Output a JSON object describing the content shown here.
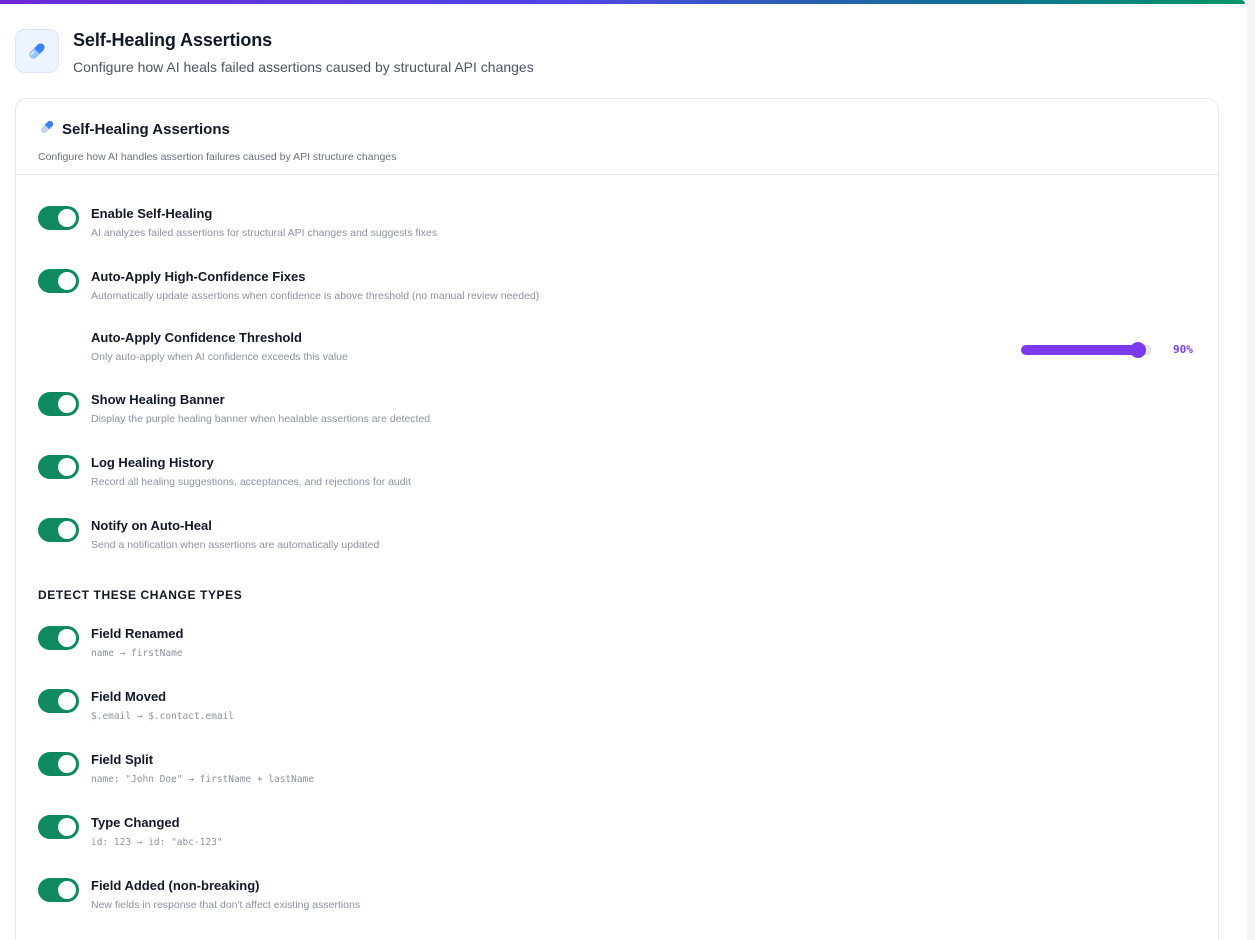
{
  "header": {
    "title": "Self-Healing Assertions",
    "subtitle": "Configure how AI heals failed assertions caused by structural API changes",
    "icon": "pill-icon"
  },
  "card": {
    "title": "Self-Healing Assertions",
    "description": "Configure how AI handles assertion failures caused by API structure changes",
    "icon": "pill-icon"
  },
  "settings": [
    {
      "label": "Enable Self-Healing",
      "description": "AI analyzes failed assertions for structural API changes and suggests fixes",
      "enabled": true
    },
    {
      "label": "Auto-Apply High-Confidence Fixes",
      "description": "Automatically update assertions when confidence is above threshold (no manual review needed)",
      "enabled": true
    },
    {
      "label": "Show Healing Banner",
      "description": "Display the purple healing banner when healable assertions are detected",
      "enabled": true
    },
    {
      "label": "Log Healing History",
      "description": "Record all healing suggestions, acceptances, and rejections for audit",
      "enabled": true
    },
    {
      "label": "Notify on Auto-Heal",
      "description": "Send a notification when assertions are automatically updated",
      "enabled": true
    }
  ],
  "threshold": {
    "label": "Auto-Apply Confidence Threshold",
    "description": "Only auto-apply when AI confidence exceeds this value",
    "value_label": "90%",
    "value": 0.9
  },
  "change_types": {
    "heading": "DETECT THESE CHANGE TYPES",
    "items": [
      {
        "label": "Field Renamed",
        "example": "name → firstName",
        "enabled": true
      },
      {
        "label": "Field Moved",
        "example": "$.email → $.contact.email",
        "enabled": true
      },
      {
        "label": "Field Split",
        "example": "name: \"John Doe\" → firstName + lastName",
        "enabled": true
      },
      {
        "label": "Type Changed",
        "example": "id: 123 → id: \"abc-123\"",
        "enabled": true
      },
      {
        "label": "Field Added (non-breaking)",
        "example": "New fields in response that don't affect existing assertions",
        "enabled": true
      }
    ]
  },
  "colors": {
    "toggle_on": "#0f8a5f",
    "accent": "#7c3aed"
  }
}
